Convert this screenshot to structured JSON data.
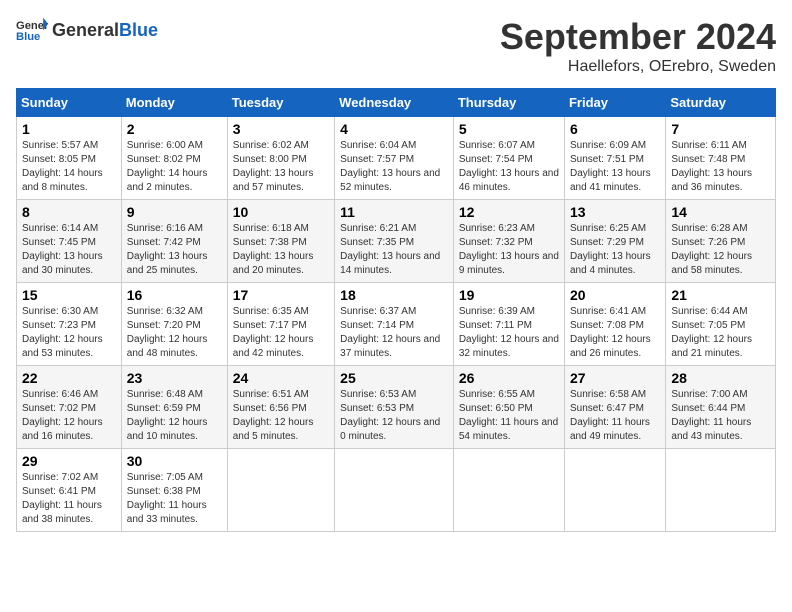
{
  "header": {
    "logo_general": "General",
    "logo_blue": "Blue",
    "month": "September 2024",
    "location": "Haellefors, OErebro, Sweden"
  },
  "weekdays": [
    "Sunday",
    "Monday",
    "Tuesday",
    "Wednesday",
    "Thursday",
    "Friday",
    "Saturday"
  ],
  "weeks": [
    [
      {
        "day": "1",
        "sunrise": "5:57 AM",
        "sunset": "8:05 PM",
        "daylight": "14 hours and 8 minutes."
      },
      {
        "day": "2",
        "sunrise": "6:00 AM",
        "sunset": "8:02 PM",
        "daylight": "14 hours and 2 minutes."
      },
      {
        "day": "3",
        "sunrise": "6:02 AM",
        "sunset": "8:00 PM",
        "daylight": "13 hours and 57 minutes."
      },
      {
        "day": "4",
        "sunrise": "6:04 AM",
        "sunset": "7:57 PM",
        "daylight": "13 hours and 52 minutes."
      },
      {
        "day": "5",
        "sunrise": "6:07 AM",
        "sunset": "7:54 PM",
        "daylight": "13 hours and 46 minutes."
      },
      {
        "day": "6",
        "sunrise": "6:09 AM",
        "sunset": "7:51 PM",
        "daylight": "13 hours and 41 minutes."
      },
      {
        "day": "7",
        "sunrise": "6:11 AM",
        "sunset": "7:48 PM",
        "daylight": "13 hours and 36 minutes."
      }
    ],
    [
      {
        "day": "8",
        "sunrise": "6:14 AM",
        "sunset": "7:45 PM",
        "daylight": "13 hours and 30 minutes."
      },
      {
        "day": "9",
        "sunrise": "6:16 AM",
        "sunset": "7:42 PM",
        "daylight": "13 hours and 25 minutes."
      },
      {
        "day": "10",
        "sunrise": "6:18 AM",
        "sunset": "7:38 PM",
        "daylight": "13 hours and 20 minutes."
      },
      {
        "day": "11",
        "sunrise": "6:21 AM",
        "sunset": "7:35 PM",
        "daylight": "13 hours and 14 minutes."
      },
      {
        "day": "12",
        "sunrise": "6:23 AM",
        "sunset": "7:32 PM",
        "daylight": "13 hours and 9 minutes."
      },
      {
        "day": "13",
        "sunrise": "6:25 AM",
        "sunset": "7:29 PM",
        "daylight": "13 hours and 4 minutes."
      },
      {
        "day": "14",
        "sunrise": "6:28 AM",
        "sunset": "7:26 PM",
        "daylight": "12 hours and 58 minutes."
      }
    ],
    [
      {
        "day": "15",
        "sunrise": "6:30 AM",
        "sunset": "7:23 PM",
        "daylight": "12 hours and 53 minutes."
      },
      {
        "day": "16",
        "sunrise": "6:32 AM",
        "sunset": "7:20 PM",
        "daylight": "12 hours and 48 minutes."
      },
      {
        "day": "17",
        "sunrise": "6:35 AM",
        "sunset": "7:17 PM",
        "daylight": "12 hours and 42 minutes."
      },
      {
        "day": "18",
        "sunrise": "6:37 AM",
        "sunset": "7:14 PM",
        "daylight": "12 hours and 37 minutes."
      },
      {
        "day": "19",
        "sunrise": "6:39 AM",
        "sunset": "7:11 PM",
        "daylight": "12 hours and 32 minutes."
      },
      {
        "day": "20",
        "sunrise": "6:41 AM",
        "sunset": "7:08 PM",
        "daylight": "12 hours and 26 minutes."
      },
      {
        "day": "21",
        "sunrise": "6:44 AM",
        "sunset": "7:05 PM",
        "daylight": "12 hours and 21 minutes."
      }
    ],
    [
      {
        "day": "22",
        "sunrise": "6:46 AM",
        "sunset": "7:02 PM",
        "daylight": "12 hours and 16 minutes."
      },
      {
        "day": "23",
        "sunrise": "6:48 AM",
        "sunset": "6:59 PM",
        "daylight": "12 hours and 10 minutes."
      },
      {
        "day": "24",
        "sunrise": "6:51 AM",
        "sunset": "6:56 PM",
        "daylight": "12 hours and 5 minutes."
      },
      {
        "day": "25",
        "sunrise": "6:53 AM",
        "sunset": "6:53 PM",
        "daylight": "12 hours and 0 minutes."
      },
      {
        "day": "26",
        "sunrise": "6:55 AM",
        "sunset": "6:50 PM",
        "daylight": "11 hours and 54 minutes."
      },
      {
        "day": "27",
        "sunrise": "6:58 AM",
        "sunset": "6:47 PM",
        "daylight": "11 hours and 49 minutes."
      },
      {
        "day": "28",
        "sunrise": "7:00 AM",
        "sunset": "6:44 PM",
        "daylight": "11 hours and 43 minutes."
      }
    ],
    [
      {
        "day": "29",
        "sunrise": "7:02 AM",
        "sunset": "6:41 PM",
        "daylight": "11 hours and 38 minutes."
      },
      {
        "day": "30",
        "sunrise": "7:05 AM",
        "sunset": "6:38 PM",
        "daylight": "11 hours and 33 minutes."
      },
      null,
      null,
      null,
      null,
      null
    ]
  ],
  "labels": {
    "sunrise": "Sunrise: ",
    "sunset": "Sunset: ",
    "daylight": "Daylight hours"
  }
}
